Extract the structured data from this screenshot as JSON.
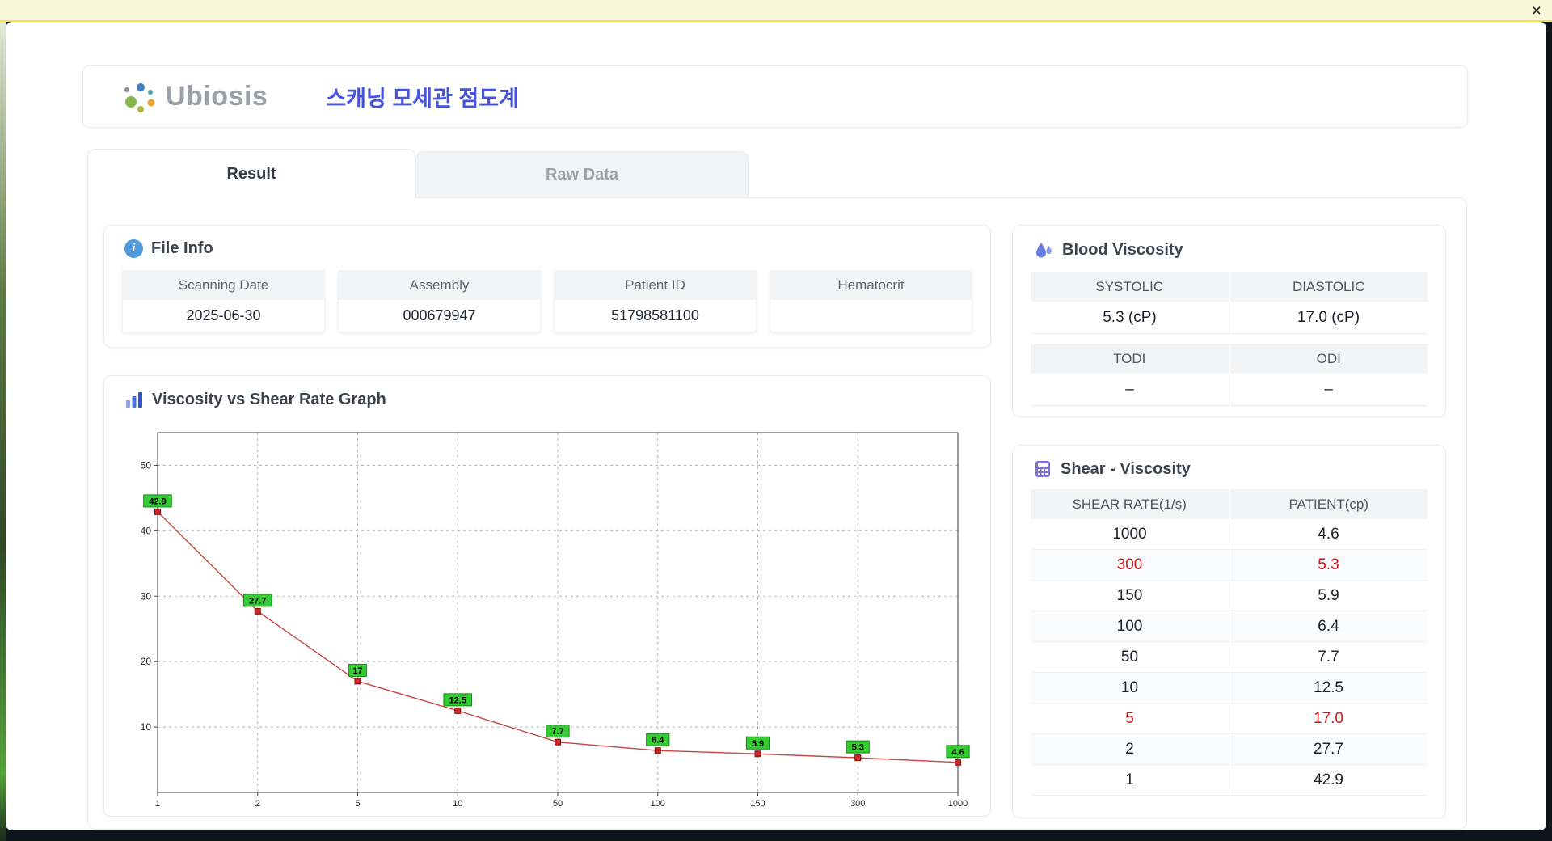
{
  "window": {
    "close_label": "×"
  },
  "header": {
    "logo_text": "Ubiosis",
    "title": "스캐닝 모세관 점도계"
  },
  "tabs": {
    "result": "Result",
    "raw_data": "Raw Data"
  },
  "file_info": {
    "title": "File Info",
    "fields": [
      {
        "label": "Scanning Date",
        "value": "2025-06-30"
      },
      {
        "label": "Assembly",
        "value": "000679947"
      },
      {
        "label": "Patient ID",
        "value": "51798581100"
      },
      {
        "label": "Hematocrit",
        "value": ""
      }
    ]
  },
  "graph": {
    "title": "Viscosity vs Shear Rate Graph"
  },
  "blood_viscosity": {
    "title": "Blood Viscosity",
    "groups": [
      {
        "headers": [
          "SYSTOLIC",
          "DIASTOLIC"
        ],
        "values": [
          "5.3 (cP)",
          "17.0 (cP)"
        ]
      },
      {
        "headers": [
          "TODI",
          "ODI"
        ],
        "values": [
          "–",
          "–"
        ]
      }
    ]
  },
  "shear_viscosity": {
    "title": "Shear - Viscosity",
    "columns": [
      "SHEAR RATE(1/s)",
      "PATIENT(cp)"
    ],
    "rows": [
      {
        "shear_rate": "1000",
        "patient": "4.6",
        "highlight": false
      },
      {
        "shear_rate": "300",
        "patient": "5.3",
        "highlight": true
      },
      {
        "shear_rate": "150",
        "patient": "5.9",
        "highlight": false
      },
      {
        "shear_rate": "100",
        "patient": "6.4",
        "highlight": false
      },
      {
        "shear_rate": "50",
        "patient": "7.7",
        "highlight": false
      },
      {
        "shear_rate": "10",
        "patient": "12.5",
        "highlight": false
      },
      {
        "shear_rate": "5",
        "patient": "17.0",
        "highlight": true
      },
      {
        "shear_rate": "2",
        "patient": "27.7",
        "highlight": false
      },
      {
        "shear_rate": "1",
        "patient": "42.9",
        "highlight": false
      }
    ]
  },
  "chart_data": {
    "type": "line",
    "title": "Viscosity vs Shear Rate Graph",
    "x_categories": [
      "1",
      "2",
      "5",
      "10",
      "50",
      "100",
      "150",
      "300",
      "1000"
    ],
    "values": [
      42.9,
      27.7,
      17,
      12.5,
      7.7,
      6.4,
      5.9,
      5.3,
      4.6
    ],
    "point_labels": [
      "42.9",
      "27.7",
      "17",
      "12.5",
      "7.7",
      "6.4",
      "5.9",
      "5.3",
      "4.6"
    ],
    "xlabel": "",
    "ylabel": "",
    "y_ticks": [
      10,
      20,
      30,
      40,
      50
    ],
    "ylim": [
      0,
      55
    ],
    "x_axis_type": "categorical",
    "grid": "dashed",
    "legend": "none",
    "line_color": "#c74444",
    "marker": "square",
    "marker_color": "#cf2626",
    "label_box_color": "#33cc33"
  },
  "colors": {
    "accent_blue": "#4553de",
    "highlight_red": "#d01818",
    "table_header_bg": "#f3f4f6",
    "title_bar_yellow": "#fbf8da"
  }
}
